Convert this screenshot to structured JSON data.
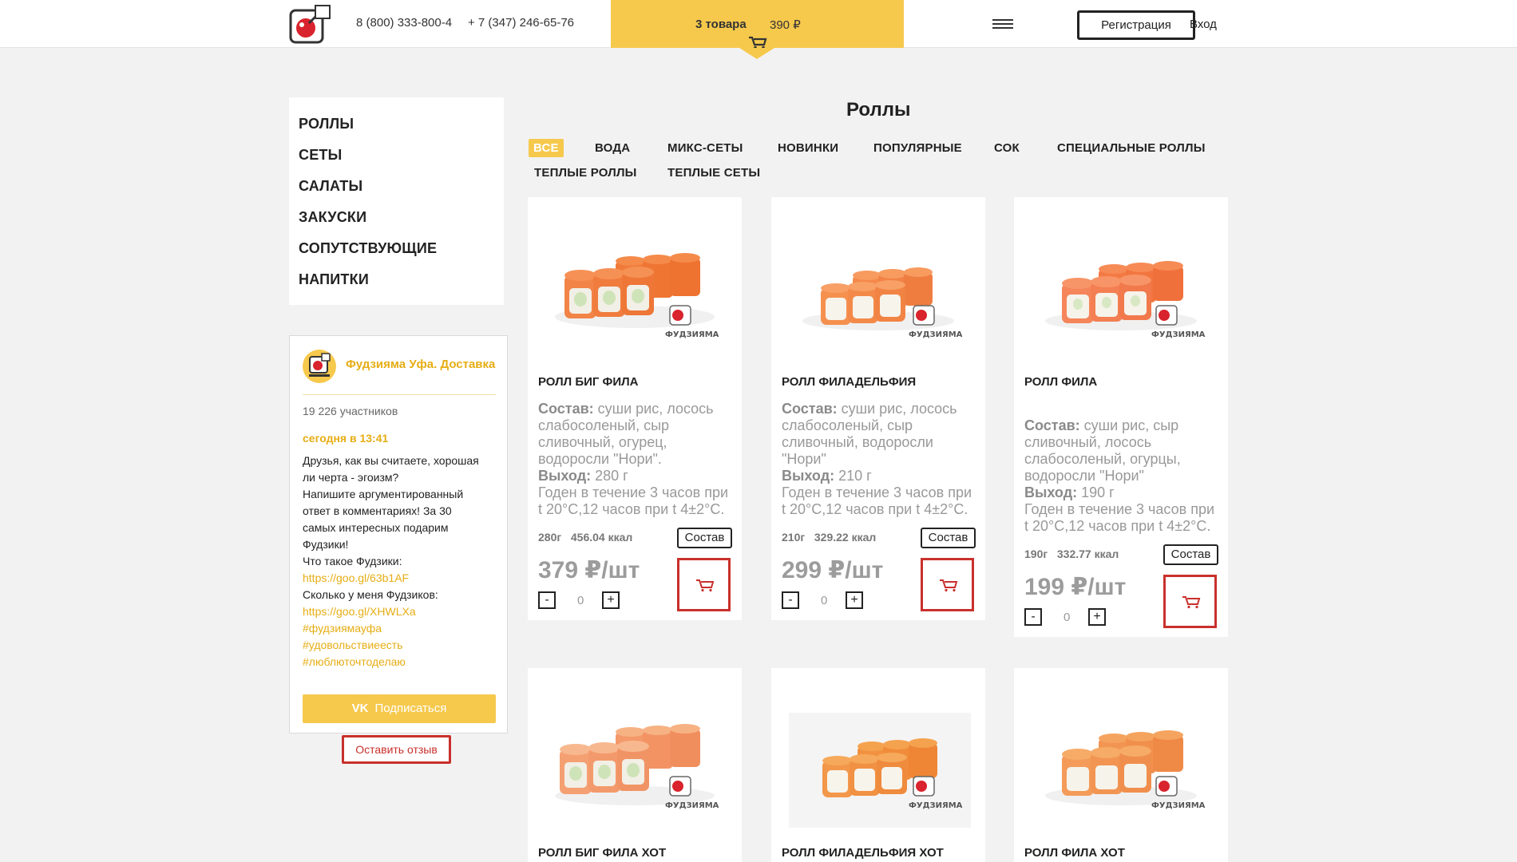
{
  "header": {
    "phone1": "8 (800) 333-800-4",
    "phone2": "+ 7 (347) 246-65-76",
    "cart_count": "3 товара",
    "cart_sum": "390 ₽",
    "register_label": "Регистрация",
    "login_label": "Вход"
  },
  "sidebar": {
    "items": [
      "РОЛЛЫ",
      "СЕТЫ",
      "САЛАТЫ",
      "ЗАКУСКИ",
      "СОПУТСТВУЮЩИЕ",
      "НАПИТКИ"
    ]
  },
  "vk_widget": {
    "group_name": "Фудзияма Уфа. Доставка",
    "members": "19 226 участников",
    "post_time": "сегодня в 13:41",
    "post_lines": [
      "Друзья, как вы считаете, хорошая",
      "ли черта - эгоизм?",
      "Напишите аргументированный",
      "ответ в комментариях! За 30",
      "самых интересных подарим",
      "Фудзики!",
      "Что такое Фудзики:"
    ],
    "link1": "https://goo.gl/63b1AF",
    "line_between": "Сколько у меня Фудзиков:",
    "link2": "https://goo.gl/XHWLXa",
    "tags": [
      "#фудзиямауфа",
      "#удовольствиеесть",
      "#люблюточтоделаю"
    ],
    "subscribe_label": "Подписаться",
    "vk_mark": "VK"
  },
  "review_button": "Оставить отзыв",
  "main": {
    "title": "Роллы",
    "categories": [
      "ВСЕ",
      "ВОДА",
      "МИКС-СЕТЫ",
      "НОВИНКИ",
      "ПОПУЛЯРНЫЕ",
      "СОК",
      "СПЕЦИАЛЬНЫЕ РОЛЛЫ",
      "ТЕПЛЫЕ РОЛЛЫ",
      "ТЕПЛЫЕ СЕТЫ"
    ],
    "active_category": "ВСЕ",
    "sostav_label": "Состав",
    "composition_prefix": "Состав:",
    "output_prefix": "Выход:",
    "brand_mark": "ФУДЗИЯМА",
    "products": [
      {
        "name": "РОЛЛ БИГ ФИЛА",
        "composition": "суши рис, лосось слабосоленый, сыр сливочный, огурец, водоросли \"Нори\".",
        "output": "280 г",
        "shelf": "Годен в течение 3 часов при t 20°С,12 часов при t 4±2°С.",
        "weight": "280г",
        "kcal": "456.04 ккал",
        "price": "379 ₽/шт",
        "qty": "0"
      },
      {
        "name": "РОЛЛ ФИЛАДЕЛЬФИЯ",
        "composition": "суши рис, лосось слабосоленый, сыр сливочный, водоросли \"Нори\"",
        "output": "210 г",
        "shelf": "Годен в течение 3 часов при t 20°С,12 часов при t 4±2°С.",
        "weight": "210г",
        "kcal": "329.22 ккал",
        "price": "299 ₽/шт",
        "qty": "0"
      },
      {
        "name": "РОЛЛ ФИЛА",
        "composition": "суши рис, сыр сливочный, лосось слабосоленый, огурцы, водоросли \"Нори\"",
        "output": "190 г",
        "shelf": "Годен в течение 3 часов при t 20°С,12 часов при t 4±2°С.",
        "weight": "190г",
        "kcal": "332.77 ккал",
        "price": "199 ₽/шт",
        "qty": "0"
      },
      {
        "name": "РОЛЛ БИГ ФИЛА ХОТ"
      },
      {
        "name": "РОЛЛ ФИЛАДЕЛЬФИЯ ХОТ"
      },
      {
        "name": "РОЛЛ ФИЛА ХОТ"
      }
    ]
  },
  "colors": {
    "accent_yellow": "#f6c94d",
    "link_yellow": "#e6ad14",
    "accent_red": "#c9302c",
    "background": "#f2f2f2"
  }
}
